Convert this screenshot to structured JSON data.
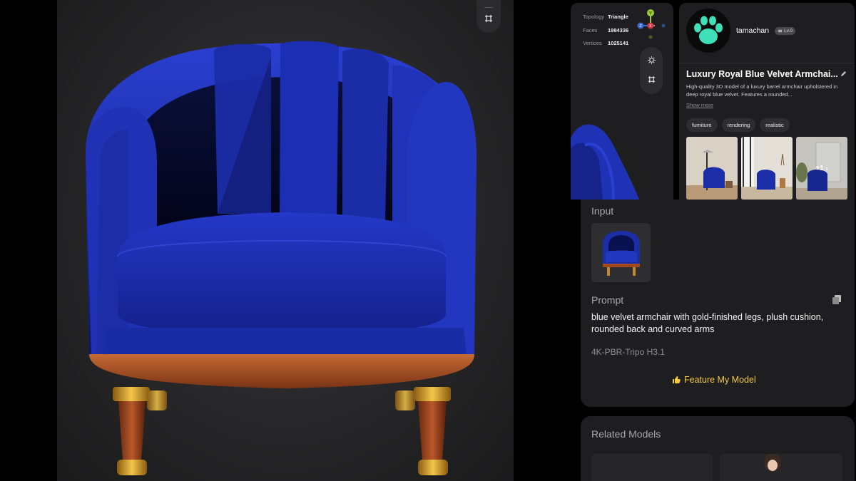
{
  "viewer": {
    "stats": [
      {
        "key": "Topology",
        "value": "Triangle"
      },
      {
        "key": "Faces",
        "value": "1984336"
      },
      {
        "key": "Vertices",
        "value": "1025141"
      }
    ],
    "gizmo": {
      "y_label": "Y",
      "x_label": "X",
      "z_label": "Z"
    }
  },
  "author": {
    "name": "tamachan",
    "level": "Lv.0",
    "avatar_icon": "paw-icon",
    "avatar_color": "#3ee0b8"
  },
  "model": {
    "title": "Luxury Royal Blue Velvet Armchai...",
    "description": "High-quality 3D model of a luxury barrel armchair upholstered in deep royal blue velvet. Features a rounded...",
    "show_more": "Show more",
    "tags": [
      "furniture",
      "rendering",
      "realistic"
    ],
    "extra_images": "+1"
  },
  "detail": {
    "input_label": "Input",
    "prompt_label": "Prompt",
    "prompt_text": "blue velvet armchair with gold-finished legs, plush cushion, rounded back and curved arms",
    "engine": "4K-PBR-Tripo H3.1",
    "feature_button": "Feature My Model",
    "feature_color": "#f6c945"
  },
  "related": {
    "label": "Related Models"
  },
  "colors": {
    "velvet": "#1a2fa8",
    "wood": "#a3491e",
    "gold": "#d9a520"
  }
}
